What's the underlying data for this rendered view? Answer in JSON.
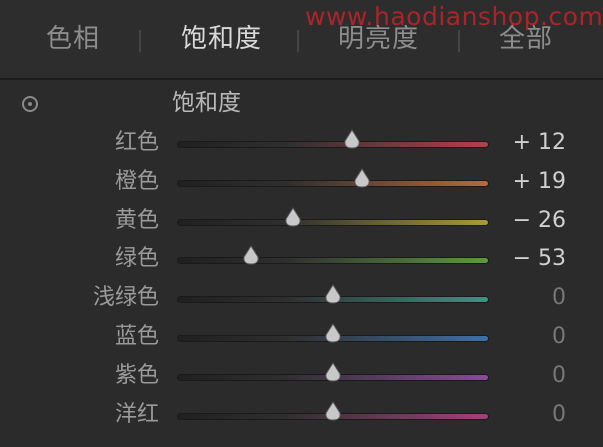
{
  "tabs": [
    {
      "label": "色相",
      "active": false
    },
    {
      "label": "饱和度",
      "active": true
    },
    {
      "label": "明亮度",
      "active": false
    },
    {
      "label": "全部",
      "active": false
    }
  ],
  "watermark": "www.haodianshop.com",
  "section": {
    "title": "饱和度",
    "target_icon": "target-adjustment-icon"
  },
  "slider_range": [
    -100,
    100
  ],
  "sliders": [
    {
      "label": "红色",
      "value": "+ 12",
      "numeric": 12,
      "color": "#b4404d"
    },
    {
      "label": "橙色",
      "value": "+ 19",
      "numeric": 19,
      "color": "#b56a3c"
    },
    {
      "label": "黄色",
      "value": "− 26",
      "numeric": -26,
      "color": "#a89a3a"
    },
    {
      "label": "绿色",
      "value": "− 53",
      "numeric": -53,
      "color": "#5c9a40"
    },
    {
      "label": "浅绿色",
      "value": "0",
      "numeric": 0,
      "color": "#3d9485"
    },
    {
      "label": "蓝色",
      "value": "0",
      "numeric": 0,
      "color": "#3f6fa6"
    },
    {
      "label": "紫色",
      "value": "0",
      "numeric": 0,
      "color": "#8a4a9c"
    },
    {
      "label": "洋红",
      "value": "0",
      "numeric": 0,
      "color": "#a4407c"
    }
  ]
}
